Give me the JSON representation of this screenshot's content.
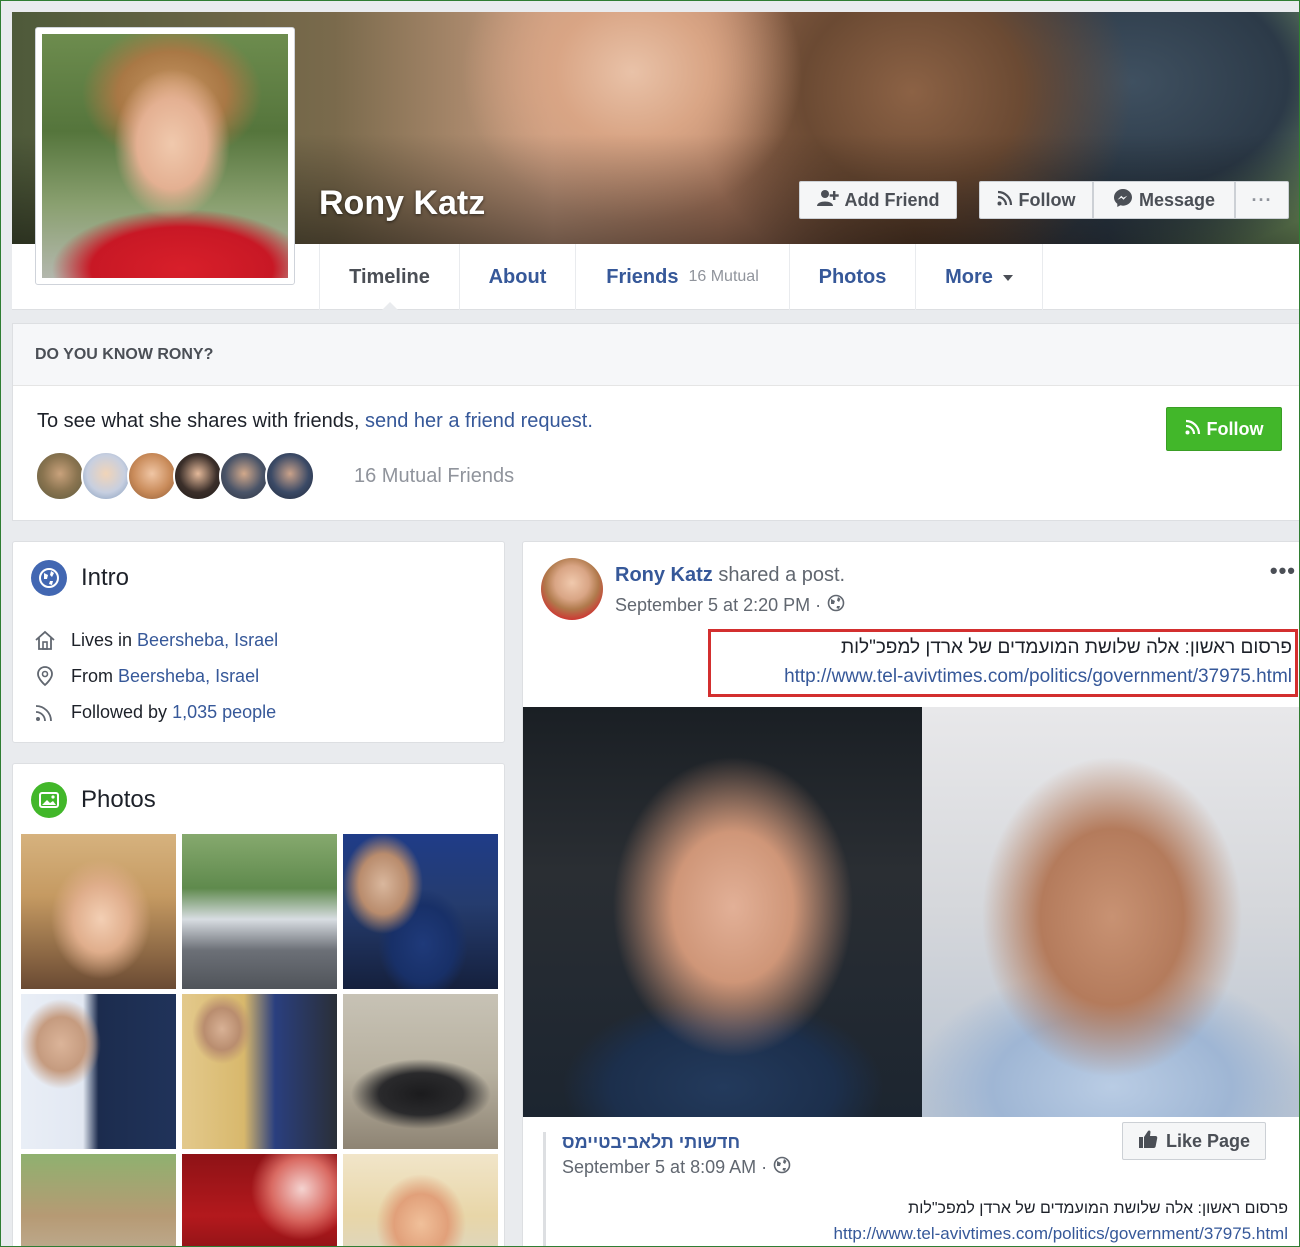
{
  "profile": {
    "name": "Rony Katz"
  },
  "cover_buttons": {
    "add_friend": "Add Friend",
    "follow": "Follow",
    "message": "Message",
    "more": "···"
  },
  "tabs": [
    {
      "label": "Timeline",
      "sub": ""
    },
    {
      "label": "About",
      "sub": ""
    },
    {
      "label": "Friends",
      "sub": "16 Mutual"
    },
    {
      "label": "Photos",
      "sub": ""
    },
    {
      "label": "More",
      "sub": ""
    }
  ],
  "know_box": {
    "heading": "DO YOU KNOW RONY?",
    "text": "To see what she shares with friends, ",
    "link": "send her a friend request.",
    "mutual": "16 Mutual Friends",
    "follow_button": "Follow"
  },
  "intro": {
    "title": "Intro",
    "lives_prefix": "Lives in ",
    "lives_place": "Beersheba, Israel",
    "from_prefix": "From ",
    "from_place": "Beersheba, Israel",
    "followed_prefix": "Followed by ",
    "followed_count": "1,035 people"
  },
  "photos": {
    "title": "Photos"
  },
  "post": {
    "author": "Rony Katz",
    "action": " shared a post.",
    "time": "September 5 at 2:20 PM · ",
    "hebrew_text": "פרסום ראשון: אלה שלושת המועמדים של ארדן למפכ\"לות",
    "link": "http://www.tel-avivtimes.com/politics/government/37975.html",
    "more": "•••",
    "shared": {
      "page_name": "חדשותי תלאביבטיימס",
      "time": "September 5 at 8:09 AM · ",
      "like_page": "Like Page",
      "hebrew_text": "פרסום ראשון: אלה שלושת המועמדים של ארדן למפכ\"לות",
      "link": "http://www.tel-avivtimes.com/politics/government/37975.html"
    }
  },
  "colors": {
    "link": "#365899",
    "follow_green": "#42b72a",
    "highlight_red": "#d32f2f"
  }
}
